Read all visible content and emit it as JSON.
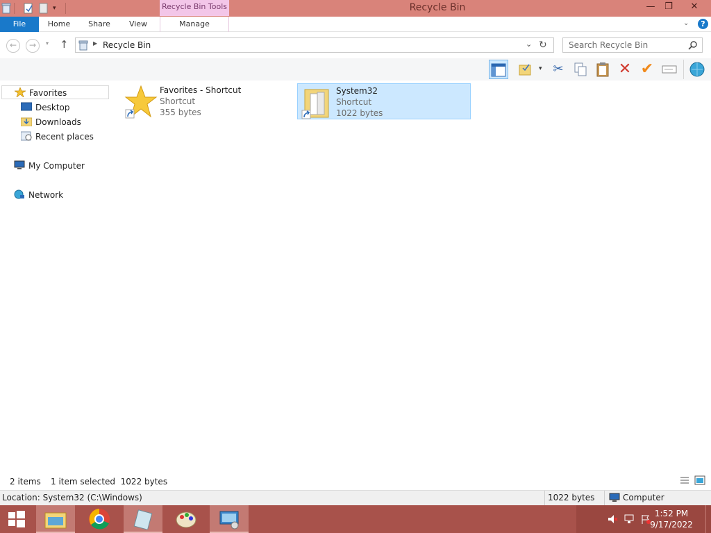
{
  "window": {
    "title": "Recycle Bin",
    "context_tab": "Recycle Bin Tools",
    "minimize": "—",
    "restore": "❐",
    "close": "✕"
  },
  "ribbon": {
    "tabs": [
      {
        "label": "File"
      },
      {
        "label": "Home"
      },
      {
        "label": "Share"
      },
      {
        "label": "View"
      },
      {
        "label": "Manage"
      }
    ],
    "help": "?"
  },
  "address": {
    "path": "Recycle Bin",
    "search_placeholder": "Search Recycle Bin"
  },
  "nav": {
    "favorites": "Favorites",
    "desktop": "Desktop",
    "downloads": "Downloads",
    "recent": "Recent places",
    "computer": "My Computer",
    "network": "Network"
  },
  "files": [
    {
      "name": "Favorites - Shortcut",
      "type": "Shortcut",
      "size": "355 bytes",
      "selected": false
    },
    {
      "name": "System32",
      "type": "Shortcut",
      "size": "1022 bytes",
      "selected": true
    }
  ],
  "status": {
    "count": "2 items",
    "selection": "1 item selected  1022 bytes"
  },
  "details": {
    "location": "Location: System32 (C:\\Windows)",
    "size": "1022 bytes",
    "zone": "Computer"
  },
  "taskbar": {
    "time": "1:52 PM",
    "date": "9/17/2022"
  },
  "colors": {
    "titlebar": "#d9837a",
    "file_tab": "#1979ca",
    "selection": "#cce8ff",
    "taskbar": "#a8524b"
  }
}
